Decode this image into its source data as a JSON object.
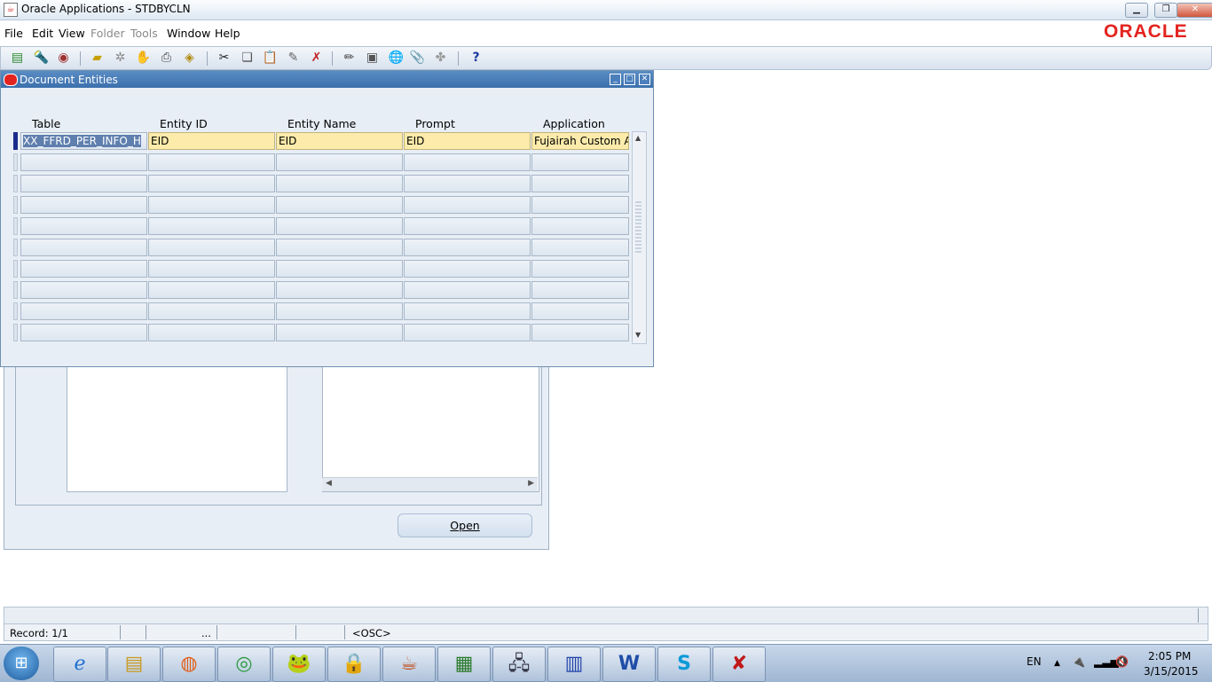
{
  "window": {
    "title": "Oracle Applications - STDBYCLN"
  },
  "menubar": {
    "items": [
      {
        "label": "File",
        "enabled": true
      },
      {
        "label": "Edit",
        "enabled": true
      },
      {
        "label": "View",
        "enabled": true
      },
      {
        "label": "Folder",
        "enabled": false
      },
      {
        "label": "Tools",
        "enabled": false
      },
      {
        "label": "Window",
        "enabled": true
      },
      {
        "label": "Help",
        "enabled": true
      }
    ],
    "logo": "ORACLE"
  },
  "toolbar": {
    "icons": [
      "new-record-icon",
      "find-icon",
      "navigator-icon",
      "save-icon",
      "next-step-icon",
      "switch-responsibility-icon",
      "print-icon",
      "close-form-icon",
      "cut-icon",
      "copy-icon",
      "paste-icon",
      "clear-record-icon",
      "delete-record-icon",
      "edit-field-icon",
      "zoom-icon",
      "translations-icon",
      "attachments-icon",
      "folder-tools-icon",
      "help-icon"
    ],
    "help_glyph": "?"
  },
  "doc_entities": {
    "title": "Document Entities",
    "columns": [
      "Table",
      "Entity ID",
      "Entity Name",
      "Prompt",
      "Application"
    ],
    "rows": [
      [
        "XX_FFRD_PER_INFO_H",
        "EID",
        "EID",
        "EID",
        "Fujairah Custom A"
      ],
      [
        "",
        "",
        "",
        "",
        ""
      ],
      [
        "",
        "",
        "",
        "",
        ""
      ],
      [
        "",
        "",
        "",
        "",
        ""
      ],
      [
        "",
        "",
        "",
        "",
        ""
      ],
      [
        "",
        "",
        "",
        "",
        ""
      ],
      [
        "",
        "",
        "",
        "",
        ""
      ],
      [
        "",
        "",
        "",
        "",
        ""
      ],
      [
        "",
        "",
        "",
        "",
        ""
      ],
      [
        "",
        "",
        "",
        "",
        ""
      ]
    ]
  },
  "bgform": {
    "open_label": "Open"
  },
  "status": {
    "record": "Record: 1/1",
    "ellipsis": "...",
    "osc": "<OSC>"
  },
  "taskbar": {
    "apps": [
      "internet-explorer-icon",
      "file-explorer-icon",
      "firefox-icon",
      "chrome-icon",
      "toad-icon",
      "remote-access-icon",
      "java-icon",
      "project-icon",
      "network-icon",
      "calendar-icon",
      "word-icon",
      "skype-icon",
      "acrobat-icon"
    ],
    "lang": "EN",
    "time": "2:05 PM",
    "date": "3/15/2015"
  },
  "colors": {
    "highlight": "#fcebaa",
    "titlebar": "#3b70ac",
    "oracle_red": "#e3231f"
  }
}
